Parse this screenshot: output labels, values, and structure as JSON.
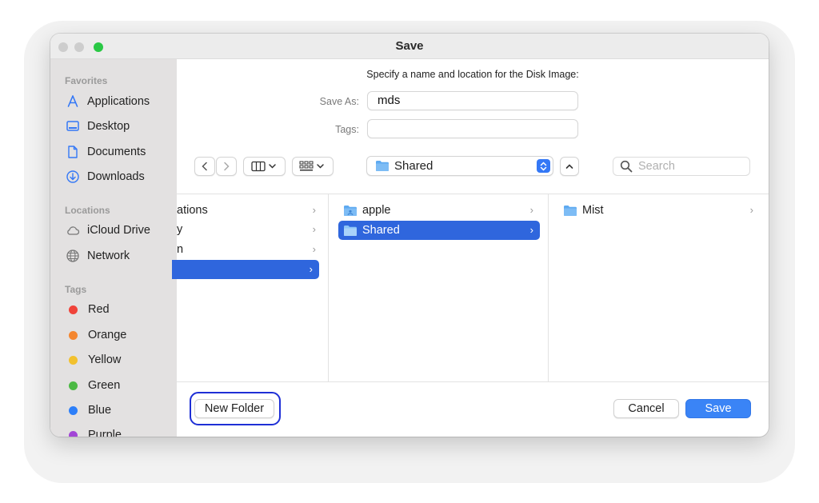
{
  "window": {
    "title": "Save"
  },
  "sidebar": {
    "favorites_header": "Favorites",
    "favorites": [
      {
        "label": "Applications",
        "icon": "applications-icon"
      },
      {
        "label": "Desktop",
        "icon": "desktop-icon"
      },
      {
        "label": "Documents",
        "icon": "documents-icon"
      },
      {
        "label": "Downloads",
        "icon": "downloads-icon"
      }
    ],
    "locations_header": "Locations",
    "locations": [
      {
        "label": "iCloud Drive",
        "icon": "cloud-icon"
      },
      {
        "label": "Network",
        "icon": "globe-icon"
      }
    ],
    "tags_header": "Tags",
    "tags": [
      {
        "label": "Red",
        "color": "#f0433a"
      },
      {
        "label": "Orange",
        "color": "#f4862f"
      },
      {
        "label": "Yellow",
        "color": "#f2c12e"
      },
      {
        "label": "Green",
        "color": "#4cb944"
      },
      {
        "label": "Blue",
        "color": "#2d7ff9"
      },
      {
        "label": "Purple",
        "color": "#a245d6"
      }
    ]
  },
  "form": {
    "prompt": "Specify a name and location for the Disk Image:",
    "save_as_label": "Save As:",
    "save_as_value": "mds",
    "tags_label": "Tags:",
    "tags_value": ""
  },
  "toolbar": {
    "location": "Shared",
    "search_placeholder": "Search"
  },
  "browser": {
    "column1": [
      {
        "label": "ations",
        "selected": false
      },
      {
        "label": "y",
        "selected": false
      },
      {
        "label": "n",
        "selected": false
      },
      {
        "label": "",
        "selected": true
      }
    ],
    "column2": [
      {
        "label": "apple",
        "selected": false
      },
      {
        "label": "Shared",
        "selected": true
      }
    ],
    "column3": [
      {
        "label": "Mist",
        "selected": false
      }
    ]
  },
  "buttons": {
    "new_folder": "New Folder",
    "cancel": "Cancel",
    "save": "Save"
  },
  "colors": {
    "accent": "#3a84f6",
    "selection": "#2f66dd",
    "focus_ring": "#1e2fd6"
  }
}
